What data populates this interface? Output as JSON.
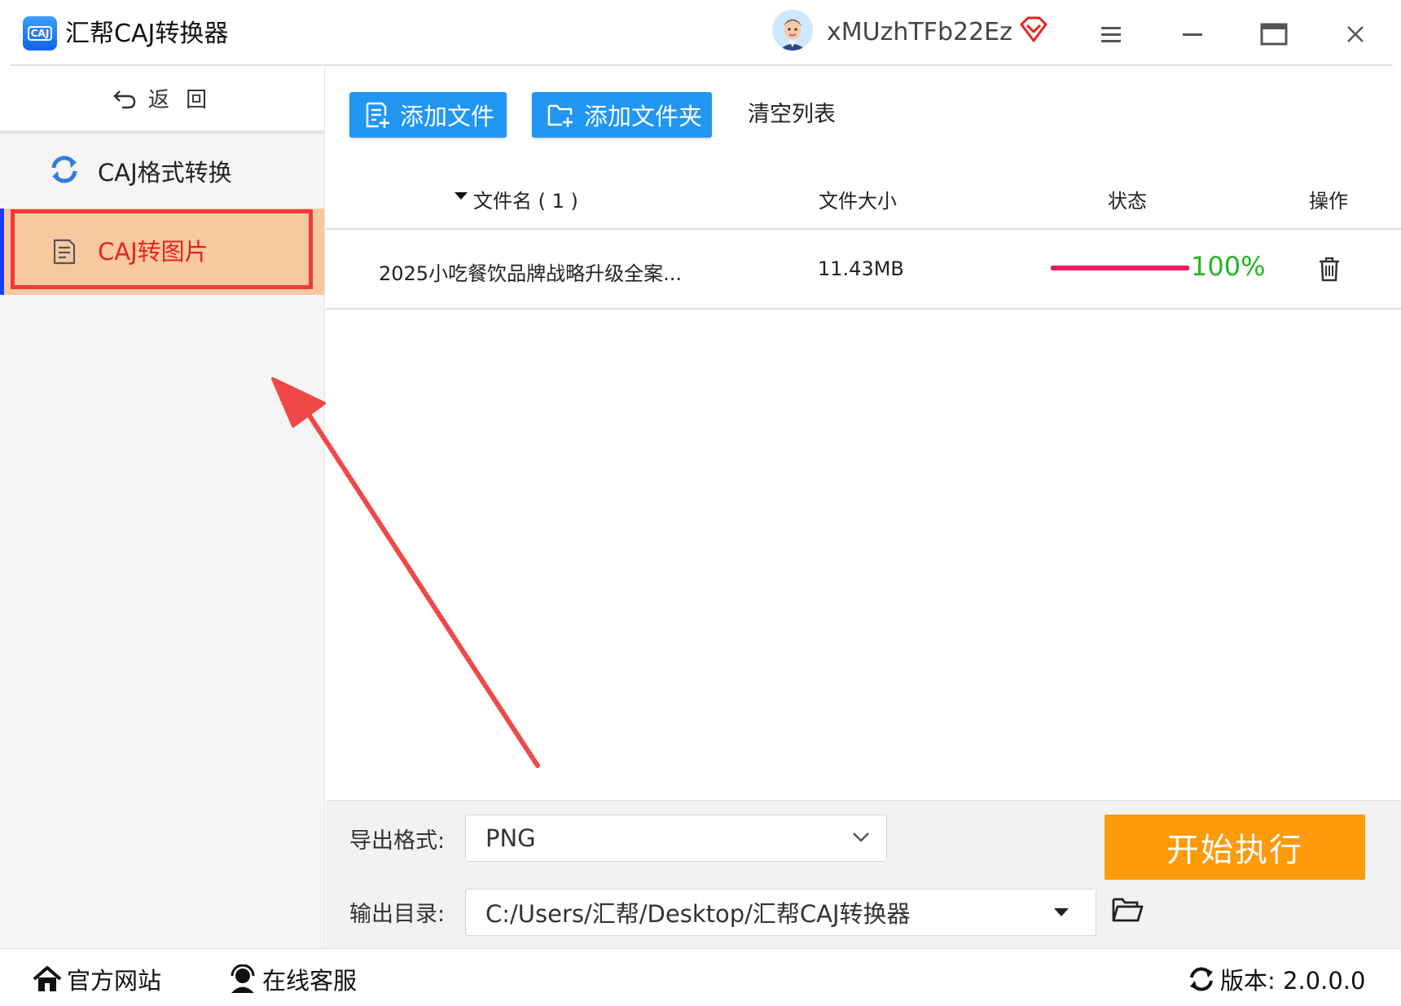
{
  "titlebar": {
    "app_title": "汇帮CAJ转换器",
    "logo_text": "CAJ",
    "username": "xMUzhTFb22Ez"
  },
  "sidebar": {
    "back_label": "返 回",
    "items": [
      {
        "label": "CAJ格式转换",
        "icon": "refresh-icon"
      },
      {
        "label": "CAJ转图片",
        "icon": "document-icon",
        "active": true
      }
    ]
  },
  "toolbar": {
    "add_file": "添加文件",
    "add_folder": "添加文件夹",
    "clear_list": "清空列表"
  },
  "table": {
    "headers": {
      "filename": "文件名 ( 1 )",
      "size": "文件大小",
      "status": "状态",
      "action": "操作"
    },
    "rows": [
      {
        "filename": "2025小吃餐饮品牌战略升级全案...",
        "size": "11.43MB",
        "progress": 1.0,
        "progress_text": "100%"
      }
    ]
  },
  "options": {
    "format_label": "导出格式:",
    "format_value": "PNG",
    "output_label": "输出目录:",
    "output_value": "C:/Users/汇帮/Desktop/汇帮CAJ转换器",
    "start_button": "开始执行"
  },
  "statusbar": {
    "website": "官方网站",
    "support": "在线客服",
    "version": "版本: 2.0.0.0"
  },
  "colors": {
    "accent_blue": "#2196f3",
    "start_orange": "#ff9a0a",
    "active_bg": "#f8c9a0",
    "active_text": "#e8231c",
    "progress": "#e91e63",
    "progress_text": "#22b522",
    "annotation_red": "#f04848"
  }
}
